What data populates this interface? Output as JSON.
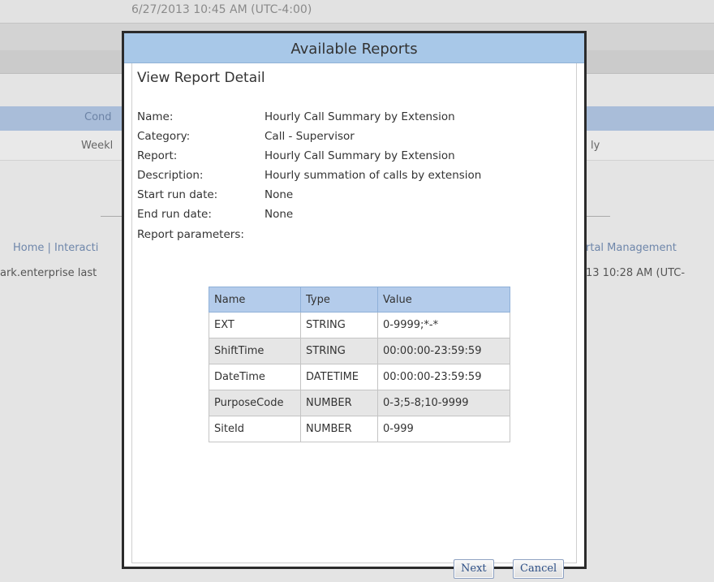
{
  "background": {
    "timestamp": "6/27/2013 10:45 AM (UTC-4:00)",
    "tab_partial": "Cond",
    "row_left_partial": "Weekl",
    "row_right_partial": "ly",
    "nav_left": "Home | Interacti",
    "nav_right": "rtal Management",
    "last_login_left": "ark.enterprise last",
    "last_login_right": "13 10:28 AM (UTC-"
  },
  "dialog": {
    "title": "Available Reports",
    "section_title": "View Report Detail",
    "details": [
      {
        "label": "Name:",
        "value": "Hourly Call Summary by Extension"
      },
      {
        "label": "Category:",
        "value": "Call - Supervisor"
      },
      {
        "label": "Report:",
        "value": "Hourly Call Summary by Extension"
      },
      {
        "label": "Description:",
        "value": "Hourly summation of calls by extension"
      },
      {
        "label": "Start run date:",
        "value": "None"
      },
      {
        "label": "End run date:",
        "value": "None"
      }
    ],
    "params_label": "Report parameters:",
    "params_table": {
      "headers": [
        "Name",
        "Type",
        "Value"
      ],
      "rows": [
        [
          "EXT",
          "STRING",
          "0-9999;*-*"
        ],
        [
          "ShiftTime",
          "STRING",
          "00:00:00-23:59:59"
        ],
        [
          "DateTime",
          "DATETIME",
          "00:00:00-23:59:59"
        ],
        [
          "PurposeCode",
          "NUMBER",
          "0-3;5-8;10-9999"
        ],
        [
          "SiteId",
          "NUMBER",
          "0-999"
        ]
      ]
    },
    "buttons": {
      "next": "Next",
      "cancel": "Cancel"
    }
  }
}
